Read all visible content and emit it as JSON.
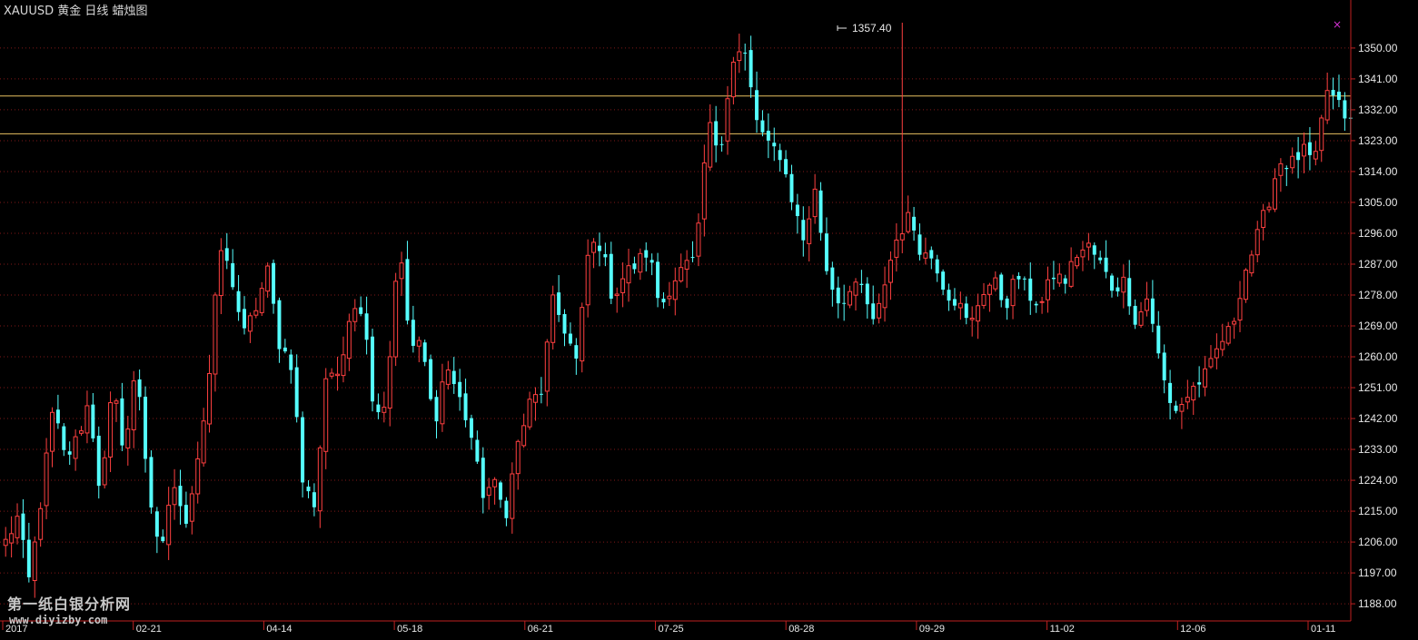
{
  "header": {
    "symbol": "XAUUSD",
    "name": "黄金",
    "period": "日线",
    "chart_kind": "蜡烛图",
    "close_mark": "×"
  },
  "watermark": {
    "line1": "第一纸白银分析网",
    "line2": "www.diyizby.com"
  },
  "colors": {
    "background": "#000000",
    "up": "#ff4040",
    "down": "#55ffff",
    "grid": "#801818",
    "axis": "#c02020",
    "hline": "#e8c060"
  },
  "chart_data": {
    "type": "candlestick",
    "title": "XAUUSD 黄金 日线 蜡烛图",
    "ylim": [
      1183,
      1364
    ],
    "y_ticks": [
      "1188.00",
      "1197.00",
      "1206.00",
      "1215.00",
      "1224.00",
      "1233.00",
      "1242.00",
      "1251.00",
      "1260.00",
      "1269.00",
      "1278.00",
      "1287.00",
      "1296.00",
      "1305.00",
      "1314.00",
      "1323.00",
      "1332.00",
      "1341.00",
      "1350.00"
    ],
    "x_labels": [
      "2017",
      "02-21",
      "04-14",
      "05-18",
      "06-21",
      "07-25",
      "08-28",
      "09-29",
      "11-02",
      "12-06",
      "01-11"
    ],
    "annotation": {
      "label": "1357.40",
      "value": 1357.4
    },
    "horizontal_lines": [
      1336.0,
      1325.0
    ],
    "waypoints": [
      1206,
      1213,
      1194,
      1219,
      1245,
      1230,
      1236,
      1247,
      1219,
      1251,
      1232,
      1258,
      1222,
      1199,
      1225,
      1210,
      1228,
      1250,
      1292,
      1283,
      1266,
      1274,
      1285,
      1264,
      1258,
      1222,
      1217,
      1258,
      1252,
      1276,
      1274,
      1244,
      1247,
      1294,
      1263,
      1263,
      1240,
      1258,
      1249,
      1239,
      1220,
      1223,
      1214,
      1234,
      1246,
      1250,
      1276,
      1268,
      1258,
      1292,
      1293,
      1277,
      1284,
      1287,
      1291,
      1274,
      1282,
      1286,
      1288,
      1328,
      1320,
      1345,
      1350,
      1330,
      1321,
      1320,
      1307,
      1294,
      1308,
      1285,
      1276,
      1279,
      1280,
      1268,
      1284,
      1296,
      1301,
      1290,
      1289,
      1279,
      1276,
      1268,
      1279,
      1282,
      1275,
      1284,
      1278,
      1275,
      1284,
      1282,
      1290,
      1292,
      1287,
      1280,
      1282,
      1270,
      1278,
      1257,
      1244,
      1247,
      1252,
      1255,
      1264,
      1268,
      1284,
      1293,
      1304,
      1317,
      1316,
      1320,
      1316,
      1338,
      1333,
      1328
    ],
    "candle_count": 232
  }
}
